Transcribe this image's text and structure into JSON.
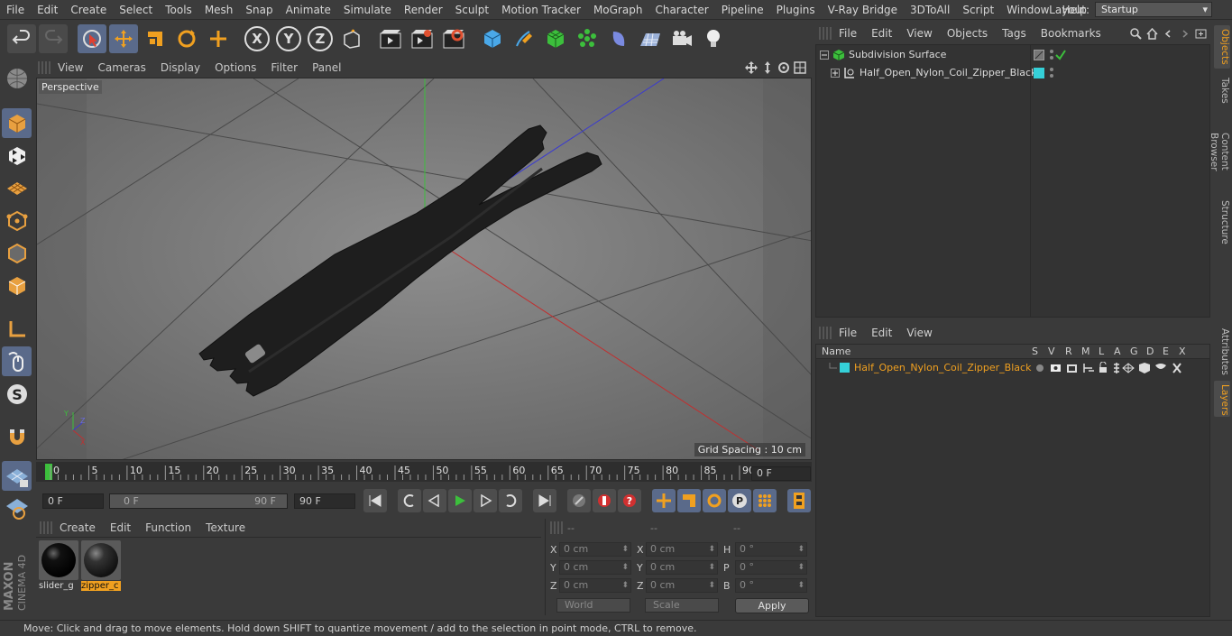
{
  "menu": [
    "File",
    "Edit",
    "Create",
    "Select",
    "Tools",
    "Mesh",
    "Snap",
    "Animate",
    "Simulate",
    "Render",
    "Sculpt",
    "Motion Tracker",
    "MoGraph",
    "Character",
    "Pipeline",
    "Plugins",
    "V-Ray Bridge",
    "3DToAll",
    "Script",
    "Window",
    "Help"
  ],
  "layout": {
    "label": "Layout:",
    "value": "Startup"
  },
  "toolbar_icons": [
    "undo-icon",
    "redo-icon",
    "live-selection-icon",
    "move-icon",
    "scale-icon",
    "rotate-icon",
    "recent-tools-icon",
    "x-axis-lock",
    "y-axis-lock",
    "z-axis-lock",
    "coordinate-system-icon",
    "render-view-icon",
    "render-picture-viewer-icon",
    "render-settings-icon",
    "cube-icon",
    "pen-icon",
    "subdivision-icon",
    "array-icon",
    "deformer-icon",
    "floor-icon",
    "camera-icon",
    "light-icon"
  ],
  "axis_labels": {
    "x": "X",
    "y": "Y",
    "z": "Z"
  },
  "viewport": {
    "menu": [
      "View",
      "Cameras",
      "Display",
      "Options",
      "Filter",
      "Panel"
    ],
    "label": "Perspective",
    "grid_spacing": "Grid Spacing : 10 cm"
  },
  "timeline": {
    "ticks": [
      "0",
      "5",
      "10",
      "15",
      "20",
      "25",
      "30",
      "35",
      "40",
      "45",
      "50",
      "55",
      "60",
      "65",
      "70",
      "75",
      "80",
      "85",
      "90"
    ],
    "current_frame": "0 F",
    "start_field": "0 F",
    "range_start": "0 F",
    "range_end": "90 F",
    "end_field": "90 F"
  },
  "materials": {
    "menu": [
      "Create",
      "Edit",
      "Function",
      "Texture"
    ],
    "items": [
      {
        "name": "slider_g",
        "selected": false
      },
      {
        "name": "zipper_c",
        "selected": true
      }
    ]
  },
  "coordinates": {
    "headers": [
      "--",
      "--",
      "--"
    ],
    "rows": [
      {
        "a_label": "X",
        "a_val": "0 cm",
        "b_label": "X",
        "b_val": "0 cm",
        "c_label": "H",
        "c_val": "0 °"
      },
      {
        "a_label": "Y",
        "a_val": "0 cm",
        "b_label": "Y",
        "b_val": "0 cm",
        "c_label": "P",
        "c_val": "0 °"
      },
      {
        "a_label": "Z",
        "a_val": "0 cm",
        "b_label": "Z",
        "b_val": "0 cm",
        "c_label": "B",
        "c_val": "0 °"
      }
    ],
    "mode": "World",
    "transform": "Scale",
    "apply": "Apply"
  },
  "object_manager": {
    "menu": [
      "File",
      "Edit",
      "View",
      "Objects",
      "Tags",
      "Bookmarks"
    ],
    "objects": [
      {
        "name": "Subdivision Surface"
      },
      {
        "name": "Half_Open_Nylon_Coil_Zipper_Black"
      }
    ],
    "object_color": "#35d0d8"
  },
  "layer_manager": {
    "menu": [
      "File",
      "Edit",
      "View"
    ],
    "columns": [
      "Name",
      "S",
      "V",
      "R",
      "M",
      "L",
      "A",
      "G",
      "D",
      "E",
      "X"
    ],
    "layers": [
      {
        "name": "Half_Open_Nylon_Coil_Zipper_Black"
      }
    ],
    "layer_color": "#35d0d8",
    "highlight_color": "#f0a020"
  },
  "right_tabs": [
    "Objects",
    "Takes",
    "Content Browser",
    "Structure",
    "Attributes",
    "Layers"
  ],
  "status": "Move: Click and drag to move elements. Hold down SHIFT to quantize movement / add to the selection in point mode, CTRL to remove.",
  "brand": [
    "MAXON",
    "CINEMA 4D"
  ]
}
